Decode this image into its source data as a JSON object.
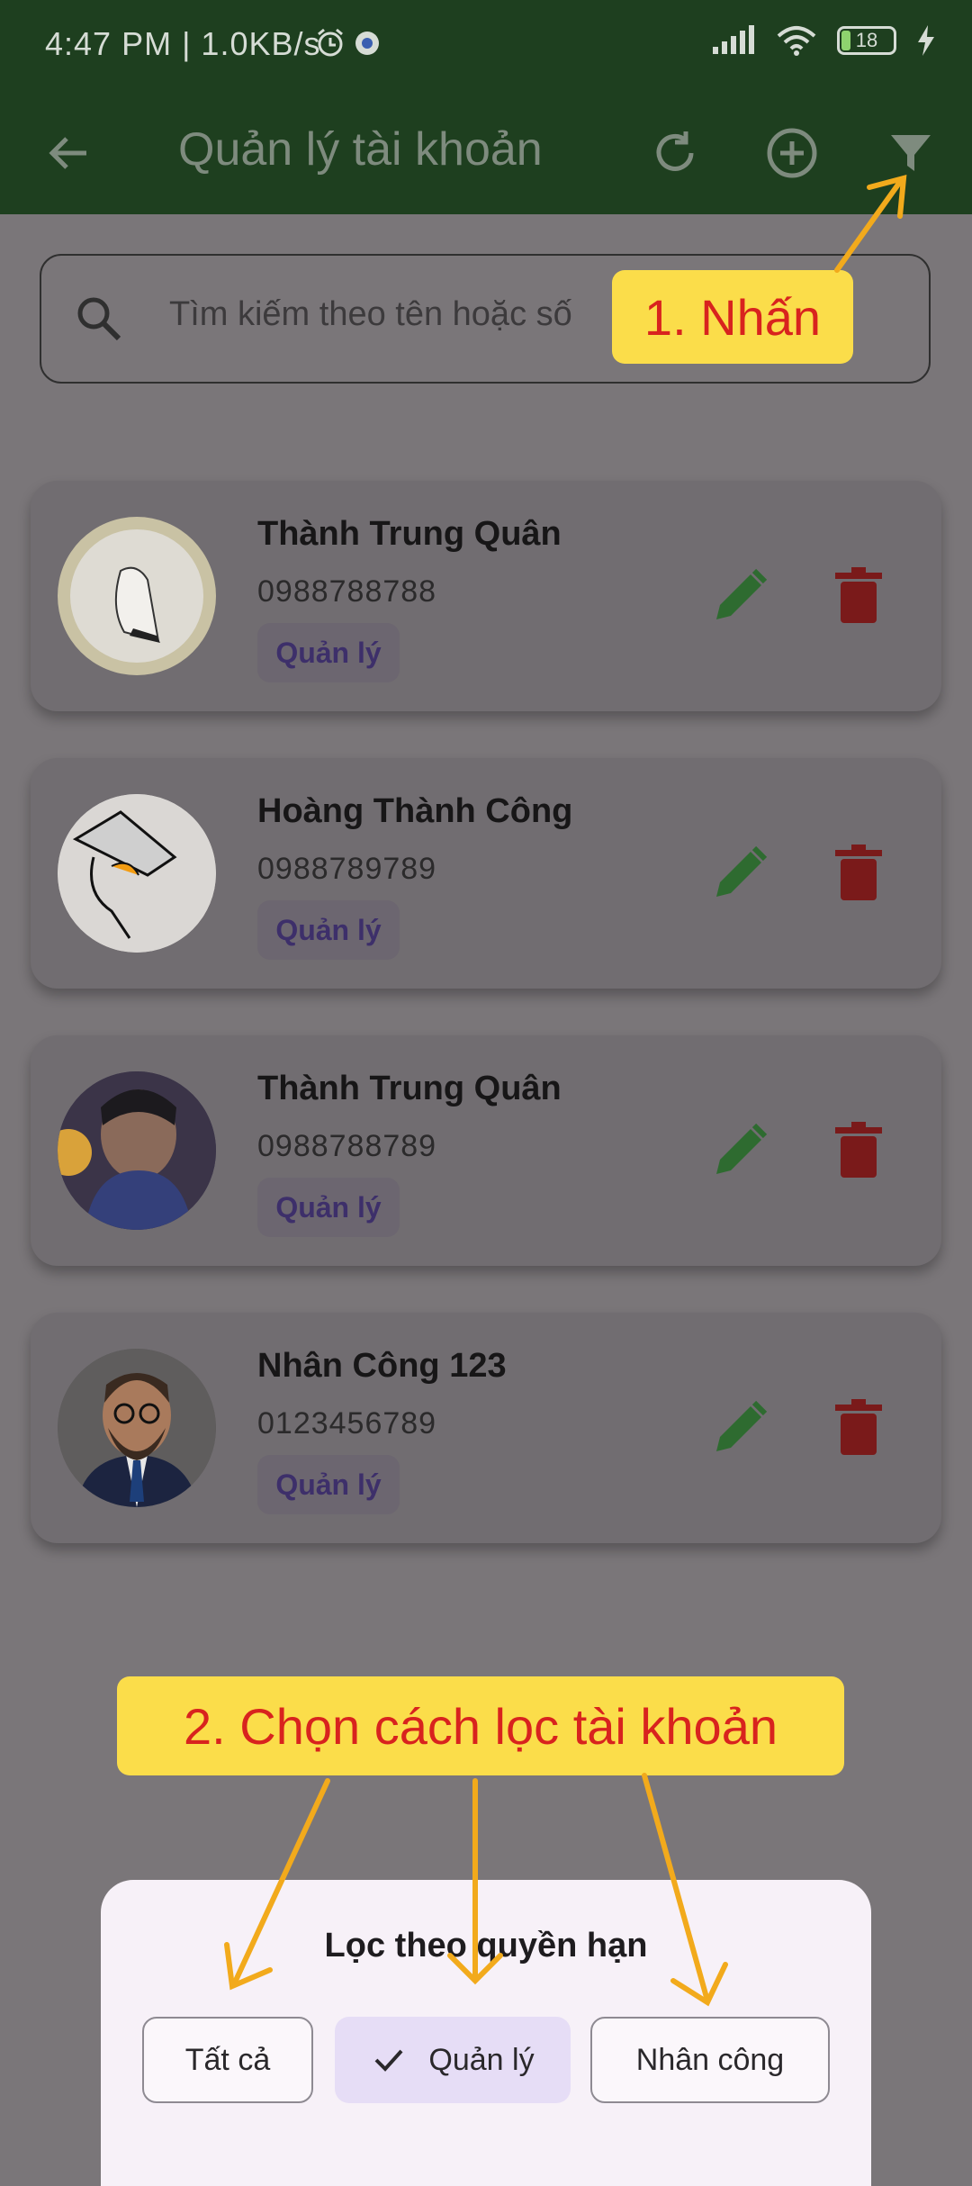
{
  "status_bar": {
    "time_speed": "4:47 PM | 1.0KB/s",
    "battery": "18"
  },
  "app_bar": {
    "title": "Quản lý tài khoản"
  },
  "search": {
    "placeholder": "Tìm kiếm theo tên hoặc số"
  },
  "accounts": [
    {
      "name": "Thành Trung Quân",
      "phone": "0988788788",
      "role": "Quản lý"
    },
    {
      "name": "Hoàng Thành Công",
      "phone": "0988789789",
      "role": "Quản lý"
    },
    {
      "name": "Thành Trung Quân",
      "phone": "0988788789",
      "role": "Quản lý"
    },
    {
      "name": "Nhân Công 123",
      "phone": "0123456789",
      "role": "Quản lý"
    }
  ],
  "callouts": {
    "step1": "1. Nhấn",
    "step2": "2. Chọn cách lọc tài khoản"
  },
  "filter_sheet": {
    "title": "Lọc theo quyền hạn",
    "options": [
      {
        "label": "Tất cả",
        "selected": false
      },
      {
        "label": "Quản lý",
        "selected": true
      },
      {
        "label": "Nhân công",
        "selected": false
      }
    ]
  },
  "colors": {
    "app_bar": "#1e3f1f",
    "callout_bg": "#fbdd4a",
    "callout_text": "#d8231e",
    "arrow": "#f2aa1c",
    "edit": "#2e7d32",
    "delete": "#8c1d1d"
  }
}
